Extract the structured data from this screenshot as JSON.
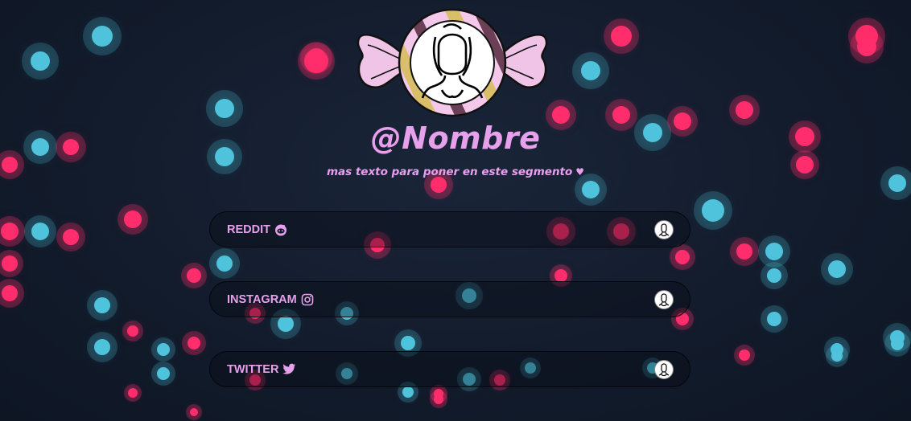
{
  "profile": {
    "username": "@Nombre",
    "tagline": "mas texto para poner en este segmento",
    "tagline_heart": "♥",
    "avatar_icon": "profile-silhouette-icon"
  },
  "links": [
    {
      "label": "REDDIT",
      "icon": "reddit-icon",
      "avatar_icon": "profile-silhouette-icon"
    },
    {
      "label": "INSTAGRAM",
      "icon": "instagram-icon",
      "avatar_icon": "profile-silhouette-icon"
    },
    {
      "label": "TWITTER",
      "icon": "twitter-icon",
      "avatar_icon": "profile-silhouette-icon"
    }
  ],
  "colors": {
    "accent_text": "#e6a0ec",
    "candy_wrapper": "#f0c4e6",
    "candy_stripe": "#d9bf6a",
    "bokeh_pink": "#ff2d6b",
    "bokeh_blue": "#4fc2dc",
    "background": "#121b2b"
  }
}
